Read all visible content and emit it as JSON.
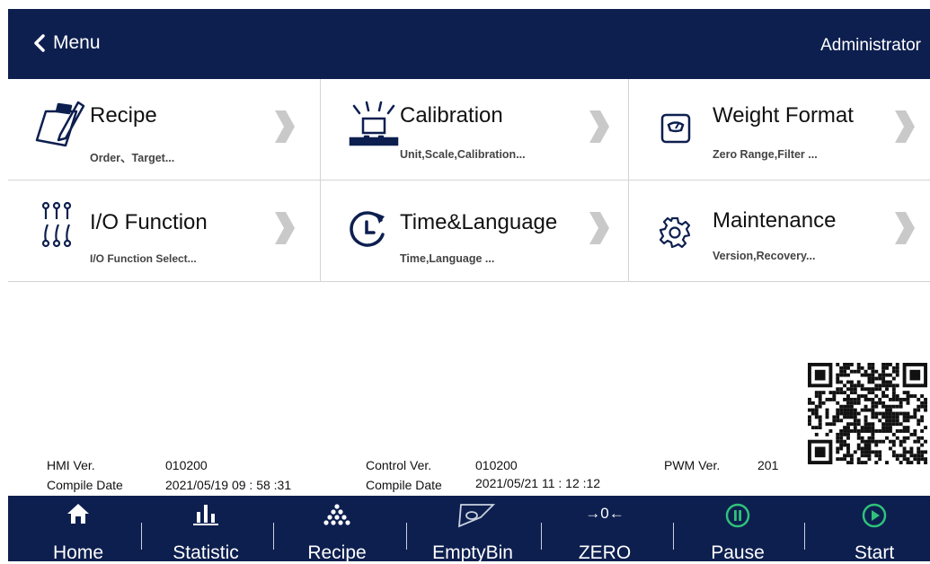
{
  "header": {
    "back_label": "Menu",
    "user_label": "Administrator"
  },
  "tiles": [
    {
      "title": "Recipe",
      "subtitle": "Order、Target..."
    },
    {
      "title": "Calibration",
      "subtitle": "Unit,Scale,Calibration..."
    },
    {
      "title": "Weight Format",
      "subtitle": "Zero Range,Filter ..."
    },
    {
      "title": "I/O Function",
      "subtitle": "I/O Function Select..."
    },
    {
      "title": "Time&Language",
      "subtitle": "Time,Language ..."
    },
    {
      "title": "Maintenance",
      "subtitle": "Version,Recovery..."
    }
  ],
  "info": {
    "hmi_ver_label": "HMI Ver.",
    "hmi_ver": "010200",
    "hmi_compile_label": "Compile Date",
    "hmi_compile": "2021/05/19  09 : 58 :31",
    "control_ver_label": "Control Ver.",
    "control_ver": "010200",
    "control_compile_label": "Compile Date",
    "control_compile": "2021/05/21  11 : 12 :12",
    "pwm_ver_label": "PWM Ver.",
    "pwm_ver": "201"
  },
  "bottom_nav": [
    {
      "label": "Home",
      "icon": "home-icon"
    },
    {
      "label": "Statistic",
      "icon": "bar-chart-icon"
    },
    {
      "label": "Recipe",
      "icon": "dots-pyramid-icon"
    },
    {
      "label": "EmptyBin",
      "icon": "empty-bin-icon"
    },
    {
      "label": "ZERO",
      "icon": "zero-icon",
      "icon_text": "→0←"
    },
    {
      "label": "Pause",
      "icon": "pause-icon"
    },
    {
      "label": "Start",
      "icon": "start-icon"
    }
  ],
  "colors": {
    "header_bg": "#0d1f4f",
    "accent_green": "#2fc27a",
    "icon_blue": "#0d1f4f"
  }
}
